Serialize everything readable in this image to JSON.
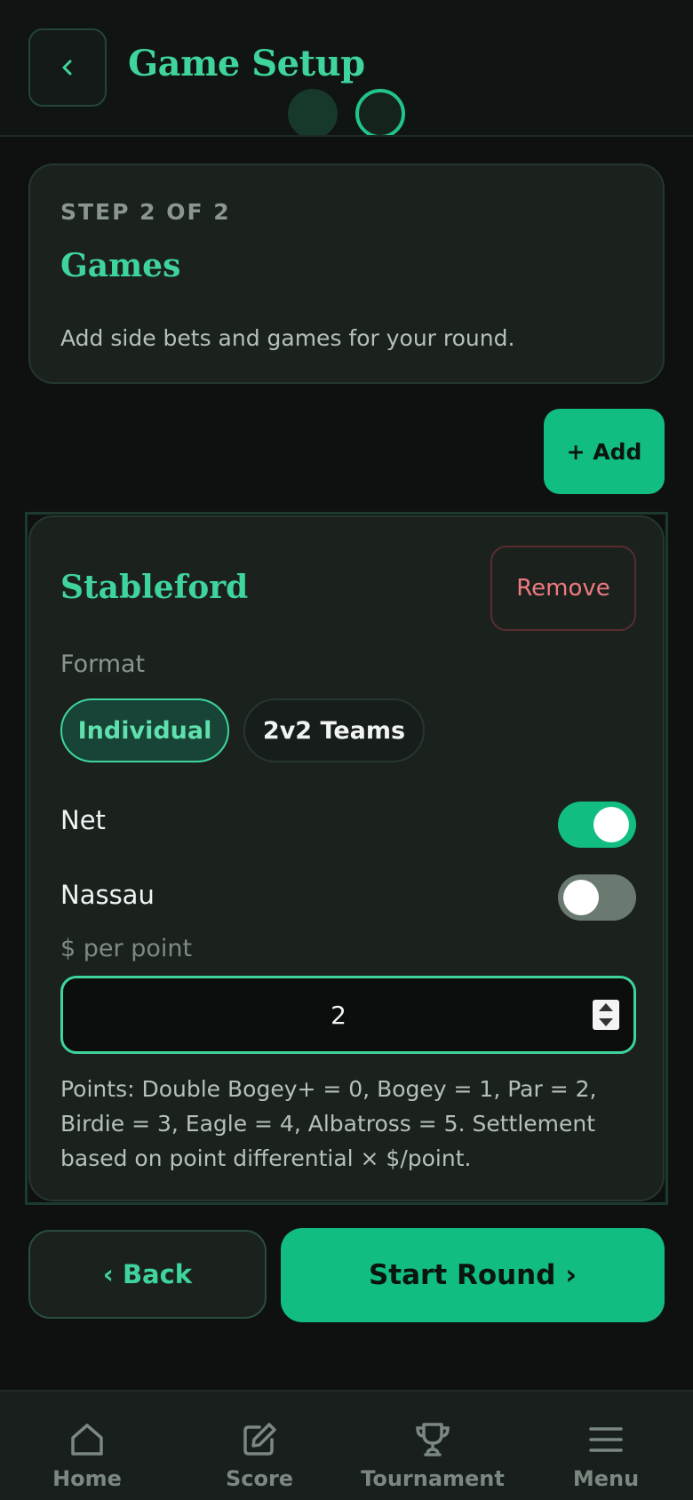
{
  "header": {
    "title": "Game Setup"
  },
  "intro": {
    "step": "STEP 2 OF 2",
    "title": "Games",
    "description": "Add side bets and games for your round."
  },
  "add_button": "+ Add",
  "game": {
    "title": "Stableford",
    "remove_label": "Remove",
    "format_label": "Format",
    "formats": [
      "Individual",
      "2v2 Teams"
    ],
    "selected_format": "Individual",
    "net_label": "Net",
    "net_on": true,
    "nassau_label": "Nassau",
    "nassau_on": false,
    "per_point_label": "$ per point",
    "per_point_value": "2",
    "points_description": "Points: Double Bogey+ = 0, Bogey = 1, Par = 2, Birdie = 3, Eagle = 4, Albatross = 5. Settlement based on point differential × $/point."
  },
  "actions": {
    "back": "‹ Back",
    "start": "Start Round ›"
  },
  "nav": [
    {
      "label": "Home",
      "icon": "home-icon"
    },
    {
      "label": "Score",
      "icon": "edit-icon"
    },
    {
      "label": "Tournament",
      "icon": "trophy-icon"
    },
    {
      "label": "Menu",
      "icon": "menu-icon"
    }
  ],
  "colors": {
    "accent": "#3fd49c",
    "primary_button": "#12bd82",
    "background": "#0e110f",
    "card": "#1b221e",
    "danger": "#ee7a7f"
  }
}
